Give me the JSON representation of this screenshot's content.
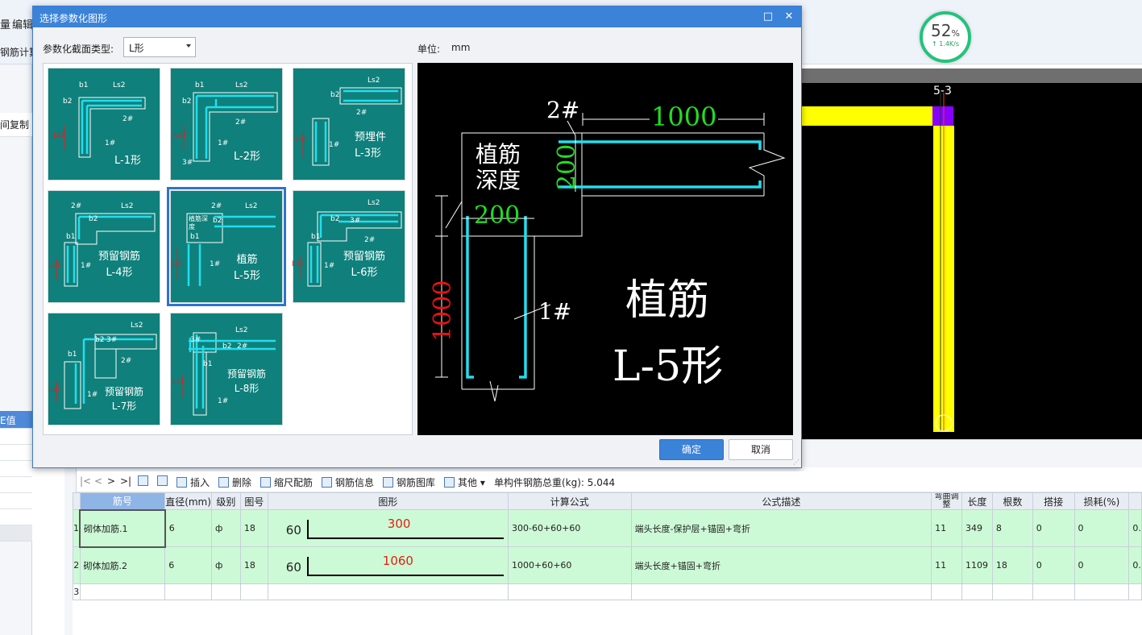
{
  "app": {
    "top_labels": [
      "量",
      "编辑",
      "钢筋计算"
    ],
    "left_labels": [
      "间复制",
      "E值"
    ]
  },
  "speed_widget": {
    "percent": "52",
    "percent_unit": "%",
    "rate": "↑ 1.4K/s"
  },
  "canvas": {
    "axis_label": "5-3"
  },
  "dialog": {
    "title": "选择参数化图形",
    "minimize_icon": "□",
    "close_icon": "✕",
    "section_type_label": "参数化截面类型:",
    "section_type_value": "L形",
    "unit_label": "单位:",
    "unit_value": "mm",
    "ok_label": "确定",
    "cancel_label": "取消",
    "thumbnails": [
      {
        "caption": "L-1形",
        "labels": [
          "b1",
          "Ls2",
          "b2",
          "2#",
          "Ls1",
          "1#"
        ]
      },
      {
        "caption": "L-2形",
        "labels": [
          "b1",
          "Ls2",
          "b2",
          "2#",
          "Ls1",
          "1#",
          "3#"
        ]
      },
      {
        "caption": "预埋件\nL-3形",
        "labels": [
          "Ls2",
          "b2",
          "2#",
          "Ls1",
          "1#"
        ]
      },
      {
        "caption": "预留钢筋\nL-4形",
        "labels": [
          "2#",
          "Ls2",
          "b2",
          "b1",
          "Ls1",
          "1#"
        ]
      },
      {
        "caption": "植筋\nL-5形",
        "labels": [
          "植筋深度",
          "2#",
          "Ls2",
          "b2",
          "b1",
          "Ls1",
          "1#"
        ]
      },
      {
        "caption": "预留钢筋\nL-6形",
        "labels": [
          "Ls2",
          "3#",
          "b2",
          "2#",
          "b1",
          "Ls1",
          "1#"
        ]
      },
      {
        "caption": "预留钢筋\nL-7形",
        "labels": [
          "Ls2",
          "b2",
          "3#",
          "b1",
          "2#",
          "Ls1",
          "1#"
        ]
      },
      {
        "caption": "预留钢筋\nL-8形",
        "labels": [
          "Ls2",
          "b2",
          "2#",
          "b1",
          "Ls1",
          "1#",
          "3#"
        ]
      }
    ],
    "preview": {
      "bar2_label": "2#",
      "bar2_length": "1000",
      "embed_label_line1": "植筋",
      "embed_label_line2": "深度",
      "b2_value": "200",
      "b1_value": "200",
      "ls1_value": "1000",
      "bar1_label": "1#",
      "title_line1": "植筋",
      "title_line2": "L-5形"
    }
  },
  "toolbar": {
    "nav": [
      "|<",
      "<",
      ">",
      ">|"
    ],
    "insert": "插入",
    "delete": "删除",
    "scale": "缩尺配筋",
    "info": "钢筋信息",
    "library": "钢筋图库",
    "other": "其他",
    "total": "单构件钢筋总重(kg): 5.044"
  },
  "grid": {
    "headers": [
      "筋号",
      "直径(mm)",
      "级别",
      "图号",
      "图形",
      "计算公式",
      "公式描述",
      "弯曲调整",
      "长度",
      "根数",
      "搭接",
      "损耗(%)",
      ""
    ],
    "rows": [
      {
        "num": "1",
        "name": "砌体加筋.1",
        "dia": "6",
        "grade": "ф",
        "fig_no": "18",
        "fig_left": "60",
        "fig_len": "300",
        "formula": "300-60+60+60",
        "desc": "端头长度-保护层+锚固+弯折",
        "bend": "11",
        "length": "349",
        "count": "8",
        "lap": "0",
        "loss": "0",
        "extra": "0."
      },
      {
        "num": "2",
        "name": "砌体加筋.2",
        "dia": "6",
        "grade": "ф",
        "fig_no": "18",
        "fig_left": "60",
        "fig_len": "1060",
        "formula": "1000+60+60",
        "desc": "端头长度+锚固+弯折",
        "bend": "11",
        "length": "1109",
        "count": "18",
        "lap": "0",
        "loss": "0",
        "extra": "0."
      }
    ],
    "empty_row_num": "3"
  }
}
